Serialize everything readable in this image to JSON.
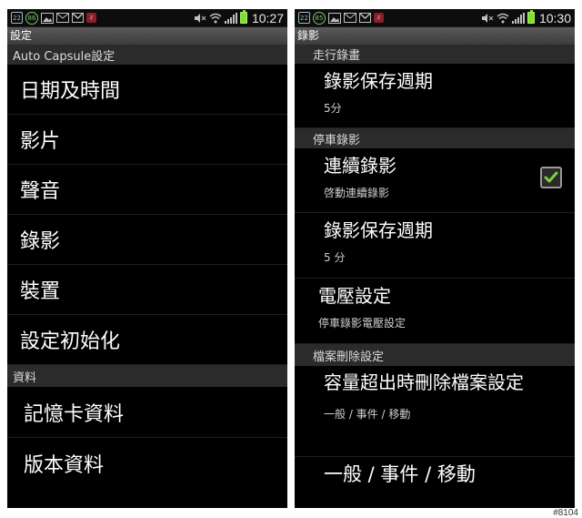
{
  "status_bar": {
    "left_phone_time": "10:27",
    "right_phone_time": "10:30",
    "calendar_badge": "22",
    "left_notification_count": "86",
    "right_notification_count": "85",
    "z_badge": "z",
    "icons": [
      "calendar-icon",
      "notification-count-icon",
      "gallery-icon",
      "email-icon",
      "gmail-icon",
      "z-app-icon",
      "mute-icon",
      "wifi-icon",
      "signal-icon",
      "battery-icon"
    ],
    "battery_color": "#7fe12e"
  },
  "left_screen": {
    "title": "設定",
    "section_header_1": "Auto Capsule設定",
    "items": [
      {
        "label": "日期及時間"
      },
      {
        "label": "影片"
      },
      {
        "label": "聲音"
      },
      {
        "label": "錄影"
      },
      {
        "label": "裝置"
      },
      {
        "label": "設定初始化"
      }
    ],
    "section_header_2": "資料",
    "items_2": [
      {
        "label": "記憶卡資料"
      },
      {
        "label": "版本資料"
      }
    ]
  },
  "right_screen": {
    "title": "錄影",
    "section_driving": "走行錄畫",
    "driving_item": {
      "title": "錄影保存週期",
      "subtitle": "5分"
    },
    "section_parking": "停車錄影",
    "continuous_item": {
      "title": "連續錄影",
      "subtitle": "啓動連續錄影",
      "checked": true
    },
    "parking_cycle_item": {
      "title": "錄影保存週期",
      "subtitle": "5 分"
    },
    "voltage_item": {
      "title": "電壓設定",
      "subtitle": "停車錄影電壓設定"
    },
    "section_delete": "檔案刪除設定",
    "delete_item": {
      "title": "容量超出時刪除檔案設定",
      "subtitle": "一般 / 事件 / 移動"
    },
    "partial_item": {
      "title": "一般 / 事件 / 移動"
    }
  },
  "watermark": "#8104",
  "colors": {
    "checkbox_check": "#7cd13a",
    "section_bg": "#2b2b2b",
    "title_bar_bg": "#4a4a4a"
  }
}
